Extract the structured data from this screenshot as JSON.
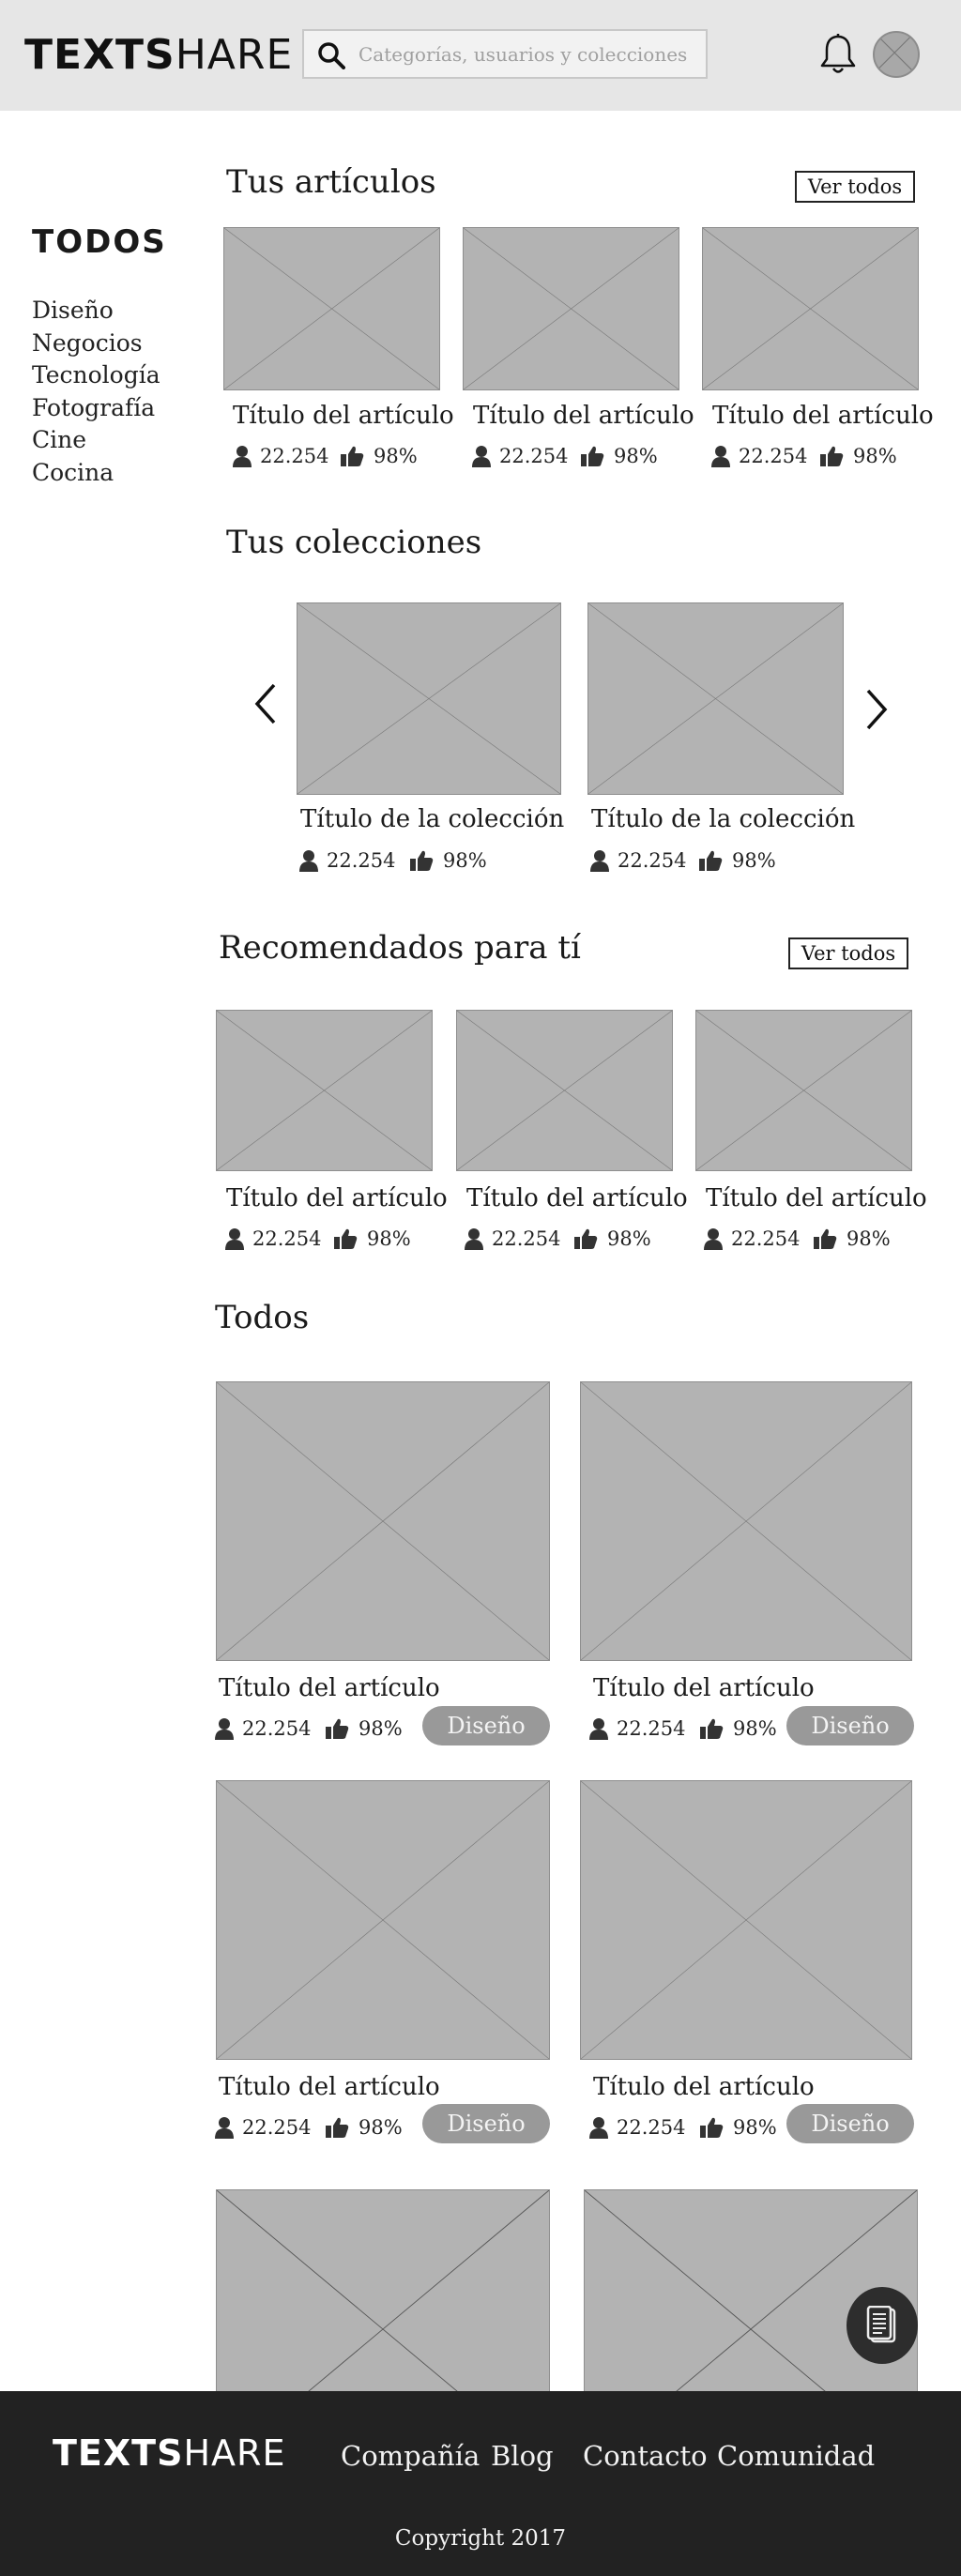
{
  "header": {
    "logo_bold": "TEXTS",
    "logo_thin": "HARE",
    "search_placeholder": "Categorías, usuarios y colecciones"
  },
  "sidebar": {
    "title": "TODOS",
    "items": [
      "Diseño",
      "Negocios",
      "Tecnología",
      "Fotografía",
      "Cine",
      "Cocina"
    ]
  },
  "articles": {
    "title": "Tus artículos",
    "button": "Ver todos",
    "cards": [
      {
        "title": "Título del artículo",
        "users": "22.254",
        "likes": "98%"
      },
      {
        "title": "Título del artículo",
        "users": "22.254",
        "likes": "98%"
      },
      {
        "title": "Título del artículo",
        "users": "22.254",
        "likes": "98%"
      }
    ]
  },
  "collections": {
    "title": "Tus colecciones",
    "cards": [
      {
        "title": "Título de la colección",
        "users": "22.254",
        "likes": "98%"
      },
      {
        "title": "Título de la colección",
        "users": "22.254",
        "likes": "98%"
      }
    ]
  },
  "recommended": {
    "title": "Recomendados para tí",
    "button": "Ver todos",
    "cards": [
      {
        "title": "Título del artículo",
        "users": "22.254",
        "likes": "98%"
      },
      {
        "title": "Título del artículo",
        "users": "22.254",
        "likes": "98%"
      },
      {
        "title": "Título del artículo",
        "users": "22.254",
        "likes": "98%"
      }
    ]
  },
  "all": {
    "title": "Todos",
    "cards": [
      {
        "title": "Título del artículo",
        "users": "22.254",
        "likes": "98%",
        "tag": "Diseño"
      },
      {
        "title": "Título del artículo",
        "users": "22.254",
        "likes": "98%",
        "tag": "Diseño"
      },
      {
        "title": "Título del artículo",
        "users": "22.254",
        "likes": "98%",
        "tag": "Diseño"
      },
      {
        "title": "Título del artículo",
        "users": "22.254",
        "likes": "98%",
        "tag": "Diseño"
      }
    ]
  },
  "footer": {
    "logo_bold": "TEXTS",
    "logo_thin": "HARE",
    "links": [
      "Compañía",
      "Blog",
      "Contacto",
      "Comunidad"
    ],
    "copyright": "Copyright 2017"
  }
}
